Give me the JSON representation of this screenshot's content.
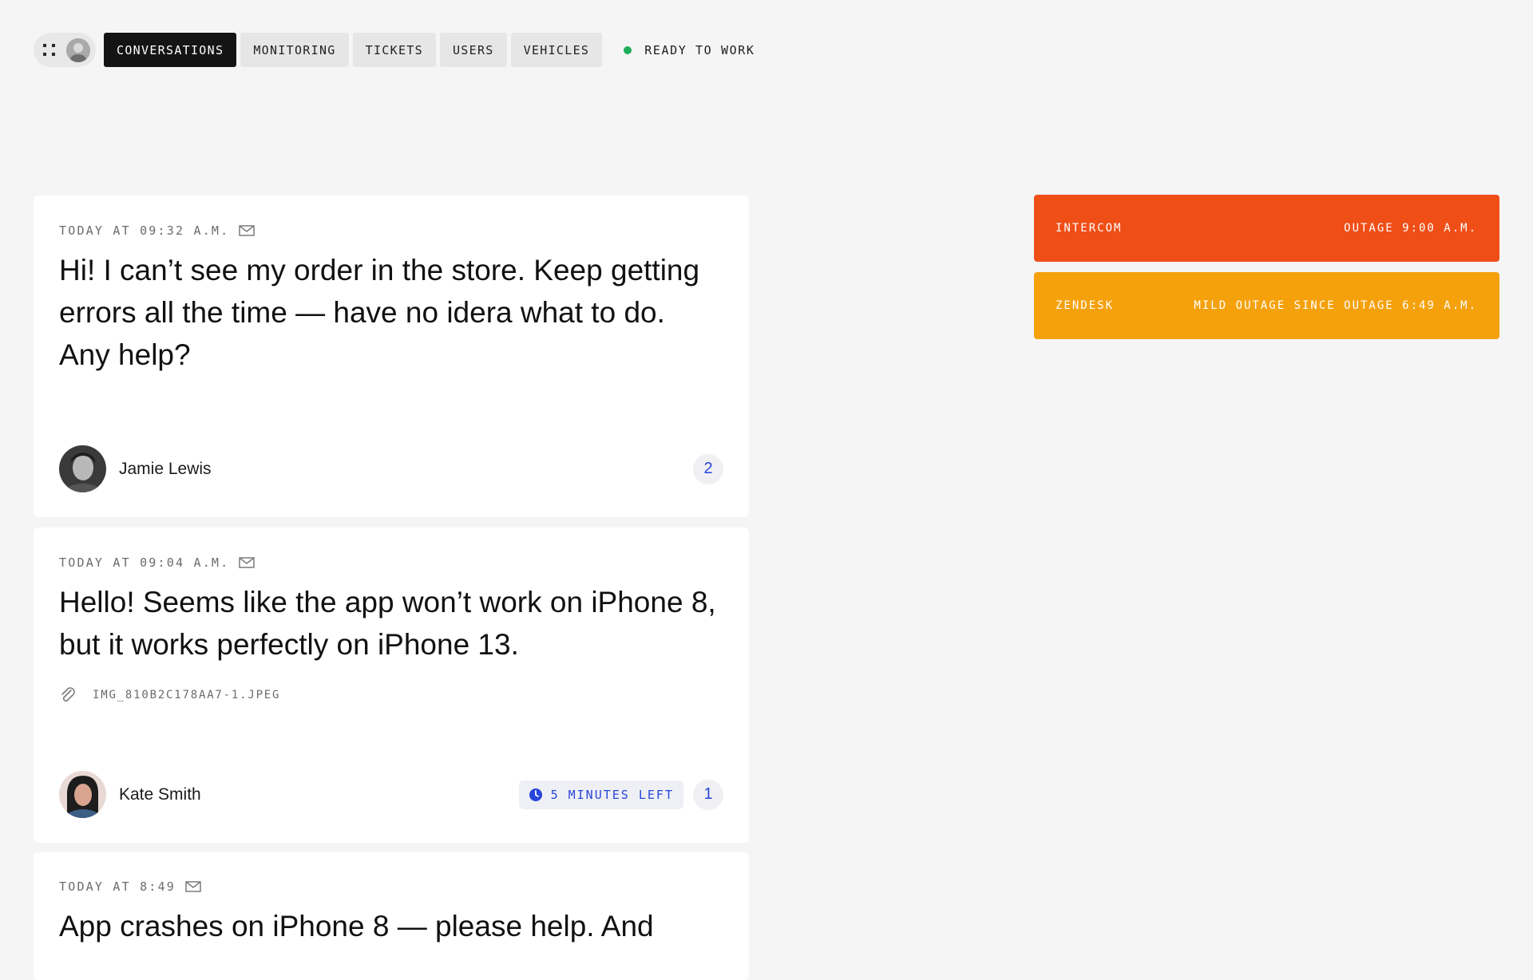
{
  "nav": {
    "tabs": [
      {
        "label": "CONVERSATIONS",
        "active": true
      },
      {
        "label": "MONITORING",
        "active": false
      },
      {
        "label": "TICKETS",
        "active": false
      },
      {
        "label": "USERS",
        "active": false
      },
      {
        "label": "VEHICLES",
        "active": false
      }
    ],
    "status": {
      "label": "READY TO WORK",
      "color": "#1fad5a"
    }
  },
  "conversations": [
    {
      "timestamp": "TODAY AT 09:32 A.M.",
      "channel_icon": "mail-icon",
      "message": "Hi! I can’t see my order in the store. Keep getting errors all the time — have no idera what to do. Any help?",
      "user": "Jamie Lewis",
      "unread_count": "2"
    },
    {
      "timestamp": "TODAY AT 09:04 A.M.",
      "channel_icon": "mail-icon",
      "message": "Hello! Seems like the app won’t work on iPhone 8, but it works perfectly on iPhone 13.",
      "attachment": "IMG_810B2C178AA7-1.JPEG",
      "user": "Kate Smith",
      "timer": "5 MINUTES LEFT",
      "unread_count": "1"
    },
    {
      "timestamp": "TODAY AT 8:49",
      "channel_icon": "mail-icon",
      "message": "App crashes on iPhone 8 — please help.  And"
    }
  ],
  "outages": [
    {
      "service": "INTERCOM",
      "status": "OUTAGE 9:00 A.M.",
      "color": "#f04e17"
    },
    {
      "service": "ZENDESK",
      "status": "MILD OUTAGE SINCE OUTAGE 6:49 A.M.",
      "color": "#f5a10c"
    }
  ],
  "colors": {
    "accent_blue": "#2745d8",
    "active_tab": "#141414",
    "background": "#f5f5f5"
  }
}
